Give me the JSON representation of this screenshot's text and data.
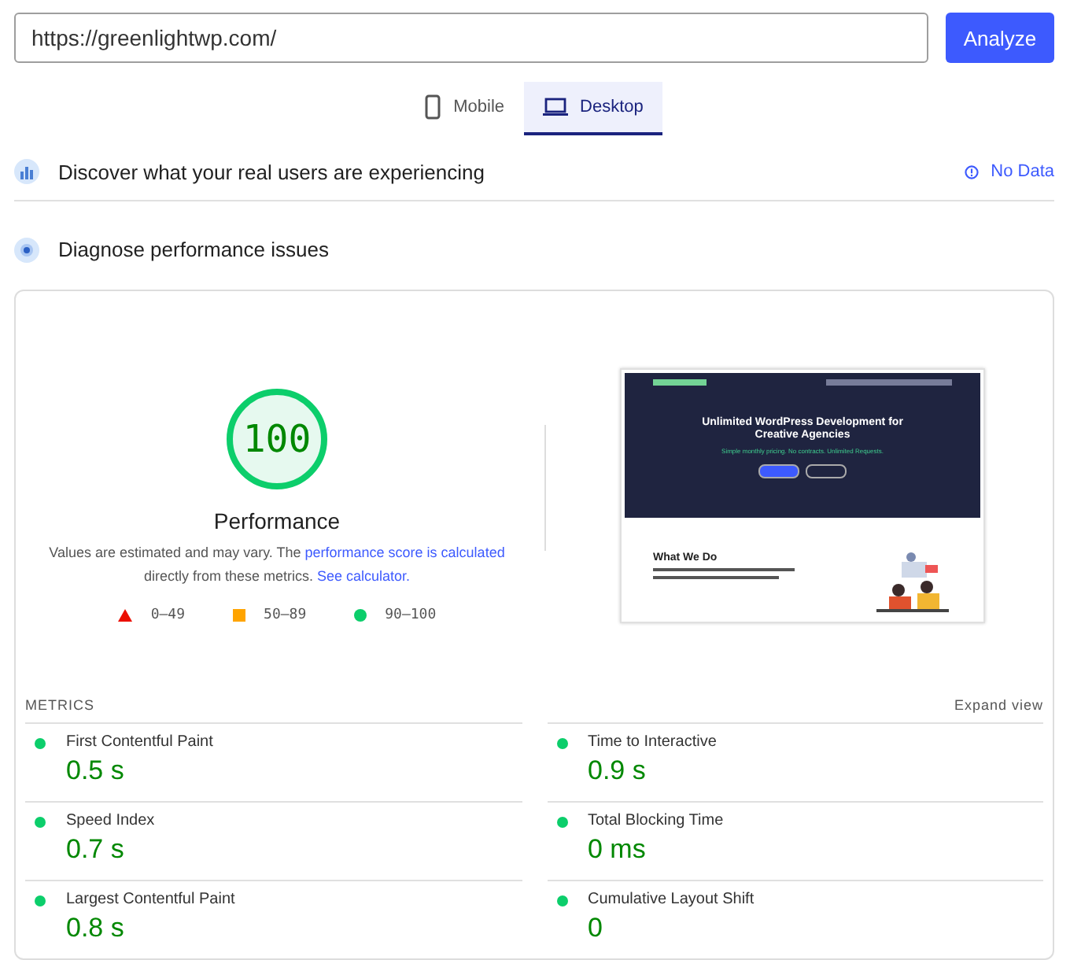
{
  "url_field": {
    "value": "https://greenlightwp.com/"
  },
  "analyze_button": "Analyze",
  "tabs": [
    {
      "label": "Mobile",
      "kind": "phone",
      "selected": false
    },
    {
      "label": "Desktop",
      "kind": "laptop",
      "selected": true
    }
  ],
  "sections": [
    {
      "kind": "field",
      "title": "Discover what your real users are experiencing",
      "status": "No Data"
    },
    {
      "kind": "lab",
      "title": "Diagnose performance issues"
    }
  ],
  "score": {
    "value": "100",
    "level": 1,
    "label": "Performance",
    "note": "Values are estimated and may vary. The ",
    "link1": "performance score is calculated",
    "note2": " directly from these metrics. ",
    "link2": "See calculator."
  },
  "legend": [
    {
      "kind": "triangle",
      "label": "0–49",
      "color": "#eb0f00"
    },
    {
      "kind": "square",
      "label": "50–89",
      "color": "#ffa400"
    },
    {
      "kind": "circle",
      "label": "90–100",
      "color": "#0cce6b"
    }
  ],
  "preview": {
    "heading": "Unlimited WordPress Development for Creative Agencies",
    "subheading": "Simple monthly pricing. No contracts. Unlimited Requests.",
    "section_title": "What We Do"
  },
  "metrics_header": "METRICS",
  "expand": "Expand view",
  "metrics": [
    {
      "name": "First Contentful Paint",
      "value": "0.5 s",
      "color": "#0cce6b"
    },
    {
      "name": "Time to Interactive",
      "value": "0.9 s",
      "color": "#0cce6b"
    },
    {
      "name": "Speed Index",
      "value": "0.7 s",
      "color": "#0cce6b"
    },
    {
      "name": "Total Blocking Time",
      "value": "0 ms",
      "color": "#0cce6b"
    },
    {
      "name": "Largest Contentful Paint",
      "value": "0.8 s",
      "color": "#0cce6b"
    },
    {
      "name": "Cumulative Layout Shift",
      "value": "0",
      "color": "#0cce6b"
    }
  ]
}
